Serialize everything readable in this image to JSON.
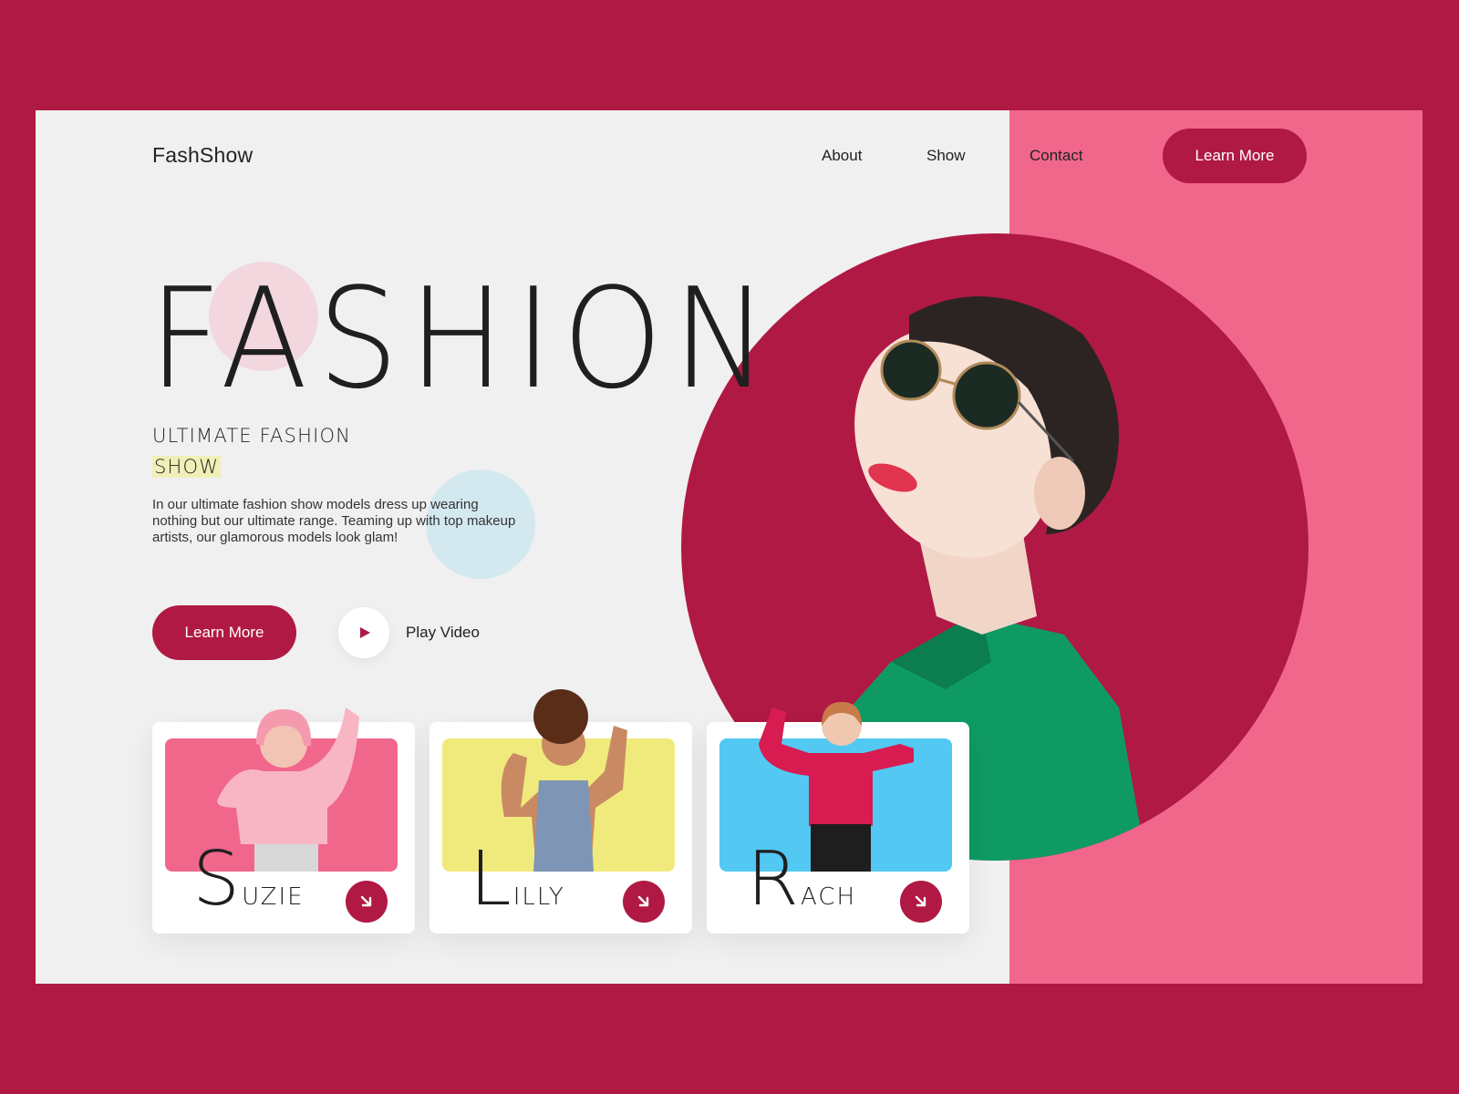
{
  "header": {
    "logo": "FashShow",
    "nav": [
      {
        "label": "About"
      },
      {
        "label": "Show"
      },
      {
        "label": "Contact"
      }
    ],
    "cta_label": "Learn More"
  },
  "hero": {
    "title": "FASHION",
    "subtitle_line1": "ULTIMATE FASHION",
    "subtitle_line2": "SHOW",
    "description": "In our ultimate fashion show models dress up wearing nothing but our ultimate range. Teaming up with top makeup artists, our glamorous models look glam!",
    "primary_button": "Learn More",
    "play_label": "Play Video"
  },
  "models": [
    {
      "initial": "S",
      "rest": "UZIE",
      "bg_color": "#f1678c",
      "icon": "arrow-down-right-icon"
    },
    {
      "initial": "L",
      "rest": "ILLY",
      "bg_color": "#f0ea7c",
      "icon": "arrow-down-right-icon"
    },
    {
      "initial": "R",
      "rest": "ACH",
      "bg_color": "#52c8f2",
      "icon": "arrow-down-right-icon"
    }
  ],
  "colors": {
    "brand": "#b01944",
    "accent_pink": "#f1678c",
    "page_bg": "#f0f0f0",
    "highlight": "#f0efb8"
  }
}
